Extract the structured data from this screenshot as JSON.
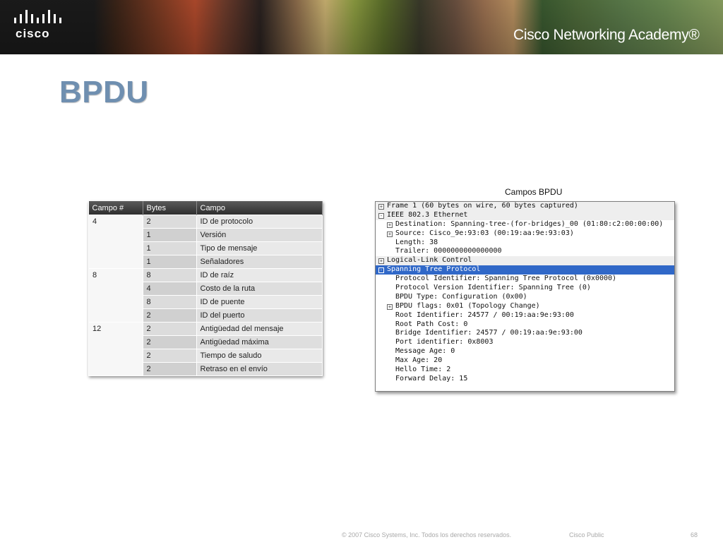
{
  "header": {
    "logo_text": "cisco",
    "academy": "Cisco Networking Academy®"
  },
  "title": "BPDU",
  "table": {
    "headers": [
      "Campo #",
      "Bytes",
      "Campo"
    ],
    "groups": [
      {
        "label": "4",
        "rows": [
          [
            "2",
            "ID de protocolo"
          ],
          [
            "1",
            "Versión"
          ],
          [
            "1",
            "Tipo de mensaje"
          ],
          [
            "1",
            "Señaladores"
          ]
        ]
      },
      {
        "label": "8",
        "rows": [
          [
            "8",
            "ID de raíz"
          ],
          [
            "4",
            "Costo de la ruta"
          ],
          [
            "8",
            "ID de puente"
          ],
          [
            "2",
            "ID del puerto"
          ]
        ]
      },
      {
        "label": "12",
        "rows": [
          [
            "2",
            "Antigüedad del mensaje"
          ],
          [
            "2",
            "Antigüedad máxima"
          ],
          [
            "2",
            "Tiempo de saludo"
          ],
          [
            "2",
            "Retraso en el envío"
          ]
        ]
      }
    ]
  },
  "packet": {
    "caption": "Campos BPDU",
    "lines": [
      {
        "text": "Frame 1 (60 bytes on wire, 60 bytes captured)",
        "level": 0,
        "toggle": "+",
        "style": "band"
      },
      {
        "text": "IEEE 802.3 Ethernet",
        "level": 0,
        "toggle": "-",
        "style": "band"
      },
      {
        "text": "Destination: Spanning-tree-(for-bridges)_00 (01:80:c2:00:00:00)",
        "level": 1,
        "toggle": "+",
        "style": ""
      },
      {
        "text": "Source: Cisco_9e:93:03 (00:19:aa:9e:93:03)",
        "level": 1,
        "toggle": "+",
        "style": ""
      },
      {
        "text": "Length: 38",
        "level": 1,
        "toggle": "",
        "style": ""
      },
      {
        "text": "Trailer: 0000000000000000",
        "level": 1,
        "toggle": "",
        "style": ""
      },
      {
        "text": "Logical-Link Control",
        "level": 0,
        "toggle": "+",
        "style": "band"
      },
      {
        "text": "Spanning Tree Protocol",
        "level": 0,
        "toggle": "-",
        "style": "selected"
      },
      {
        "text": "Protocol Identifier: Spanning Tree Protocol (0x0000)",
        "level": 1,
        "toggle": "",
        "style": ""
      },
      {
        "text": "Protocol Version Identifier: Spanning Tree (0)",
        "level": 1,
        "toggle": "",
        "style": ""
      },
      {
        "text": "BPDU Type: Configuration (0x00)",
        "level": 1,
        "toggle": "",
        "style": ""
      },
      {
        "text": "BPDU flags: 0x01 (Topology Change)",
        "level": 1,
        "toggle": "+",
        "style": ""
      },
      {
        "text": "Root Identifier: 24577 / 00:19:aa:9e:93:00",
        "level": 1,
        "toggle": "",
        "style": ""
      },
      {
        "text": "Root Path Cost: 0",
        "level": 1,
        "toggle": "",
        "style": ""
      },
      {
        "text": "Bridge Identifier: 24577 / 00:19:aa:9e:93:00",
        "level": 1,
        "toggle": "",
        "style": ""
      },
      {
        "text": "Port identifier: 0x8003",
        "level": 1,
        "toggle": "",
        "style": ""
      },
      {
        "text": "Message Age: 0",
        "level": 1,
        "toggle": "",
        "style": ""
      },
      {
        "text": "Max Age: 20",
        "level": 1,
        "toggle": "",
        "style": ""
      },
      {
        "text": "Hello Time: 2",
        "level": 1,
        "toggle": "",
        "style": ""
      },
      {
        "text": "Forward Delay: 15",
        "level": 1,
        "toggle": "",
        "style": ""
      }
    ]
  },
  "footer": {
    "copyright": "© 2007 Cisco Systems, Inc. Todos los derechos reservados.",
    "classification": "Cisco Public",
    "page": "68"
  },
  "colors": {
    "title": "#6f8fb0",
    "selection": "#3068c8",
    "header_dark": "#2e2e2e"
  }
}
